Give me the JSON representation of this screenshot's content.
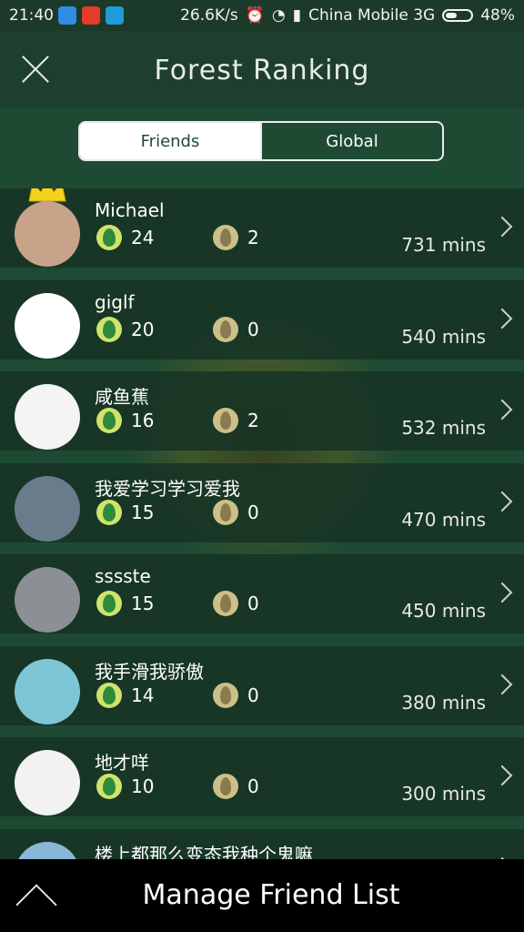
{
  "status_bar": {
    "time": "21:40",
    "network_speed": "26.6K/s",
    "carrier": "China Mobile 3G",
    "battery": "48%",
    "battery_level": 0.48
  },
  "header": {
    "title": "Forest Ranking",
    "close_icon": "close-icon"
  },
  "tabs": [
    {
      "label": "Friends",
      "active": true
    },
    {
      "label": "Global",
      "active": false
    }
  ],
  "rankings": [
    {
      "name": "Michael",
      "trees": "24",
      "dead": "2",
      "time": "731 mins",
      "crown": true,
      "avatar_color": "#c9a28a"
    },
    {
      "name": "giglf",
      "trees": "20",
      "dead": "0",
      "time": "540 mins",
      "crown": false,
      "avatar_color": "#ffffff"
    },
    {
      "name": "咸鱼蕉",
      "trees": "16",
      "dead": "2",
      "time": "532 mins",
      "crown": false,
      "avatar_color": "#f4f4f4"
    },
    {
      "name": "我爱学习学习爱我",
      "trees": "15",
      "dead": "0",
      "time": "470 mins",
      "crown": false,
      "avatar_color": "#6a7c8c"
    },
    {
      "name": "sssste",
      "trees": "15",
      "dead": "0",
      "time": "450 mins",
      "crown": false,
      "avatar_color": "#8c8f94"
    },
    {
      "name": "我手滑我骄傲",
      "trees": "14",
      "dead": "0",
      "time": "380 mins",
      "crown": false,
      "avatar_color": "#7ec6d6"
    },
    {
      "name": "地才咩",
      "trees": "10",
      "dead": "0",
      "time": "300 mins",
      "crown": false,
      "avatar_color": "#f2f2f2"
    },
    {
      "name": "楼上都那么变态我种个鬼嘛",
      "trees": "",
      "dead": "",
      "time": "",
      "crown": false,
      "avatar_color": "#8ab6d8"
    }
  ],
  "footer": {
    "label": "Manage Friend List"
  }
}
